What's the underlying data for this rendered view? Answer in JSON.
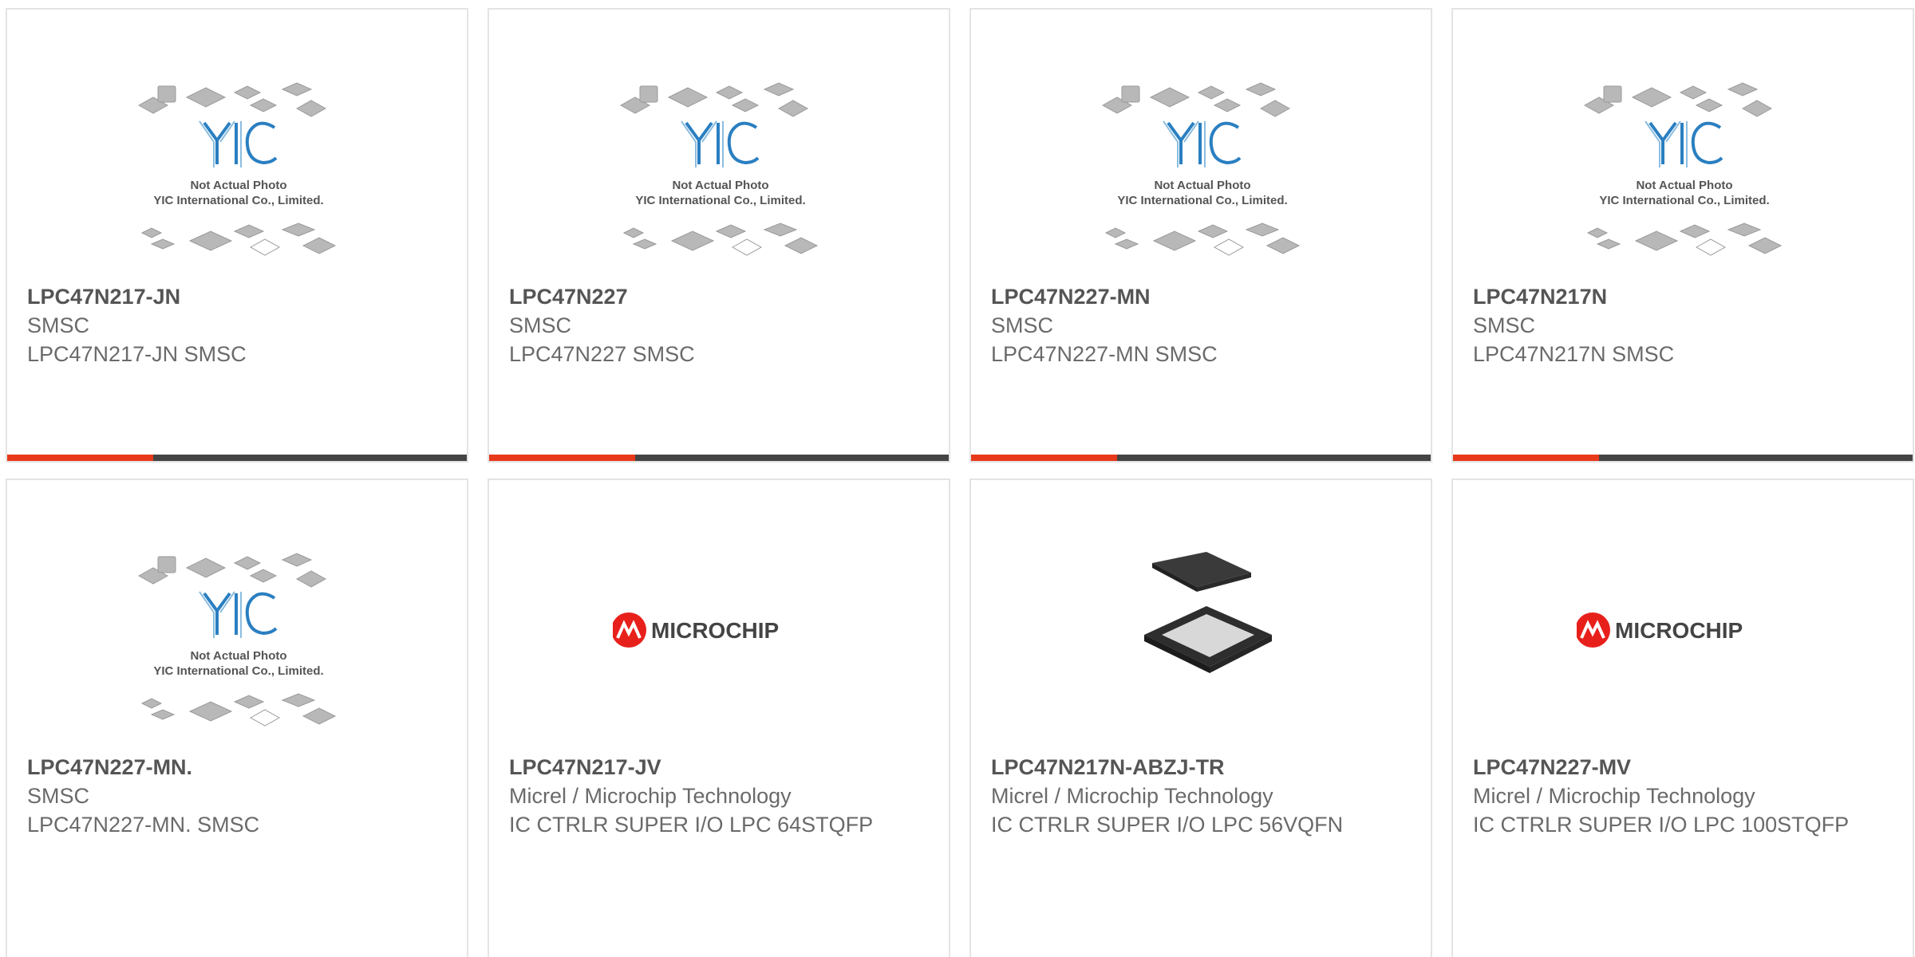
{
  "colors": {
    "accent_red": "#e8391b",
    "accent_dark": "#444444",
    "yic_blue": "#2a7fc1",
    "microchip_red": "#e8201c"
  },
  "placeholder_image": {
    "brand": "YIC",
    "line1": "Not Actual Photo",
    "line2": "YIC International Co., Limited."
  },
  "microchip_logo": {
    "text": "MICROCHIP"
  },
  "products": [
    {
      "part_number": "LPC47N217-JN",
      "manufacturer": "SMSC",
      "description": "LPC47N217-JN SMSC",
      "image": "yic-placeholder"
    },
    {
      "part_number": "LPC47N227",
      "manufacturer": "SMSC",
      "description": "LPC47N227 SMSC",
      "image": "yic-placeholder"
    },
    {
      "part_number": "LPC47N227-MN",
      "manufacturer": "SMSC",
      "description": "LPC47N227-MN SMSC",
      "image": "yic-placeholder"
    },
    {
      "part_number": "LPC47N217N",
      "manufacturer": "SMSC",
      "description": "LPC47N217N SMSC",
      "image": "yic-placeholder"
    },
    {
      "part_number": "LPC47N227-MN.",
      "manufacturer": "SMSC",
      "description": "LPC47N227-MN. SMSC",
      "image": "yic-placeholder"
    },
    {
      "part_number": "LPC47N217-JV",
      "manufacturer": "Micrel / Microchip Technology",
      "description": "IC CTRLR SUPER I/O LPC 64STQFP",
      "image": "microchip-logo"
    },
    {
      "part_number": "LPC47N217N-ABZJ-TR",
      "manufacturer": "Micrel / Microchip Technology",
      "description": "IC CTRLR SUPER I/O LPC 56VQFN",
      "image": "qfn-chip"
    },
    {
      "part_number": "LPC47N227-MV",
      "manufacturer": "Micrel / Microchip Technology",
      "description": "IC CTRLR SUPER I/O LPC 100STQFP",
      "image": "microchip-logo"
    }
  ]
}
